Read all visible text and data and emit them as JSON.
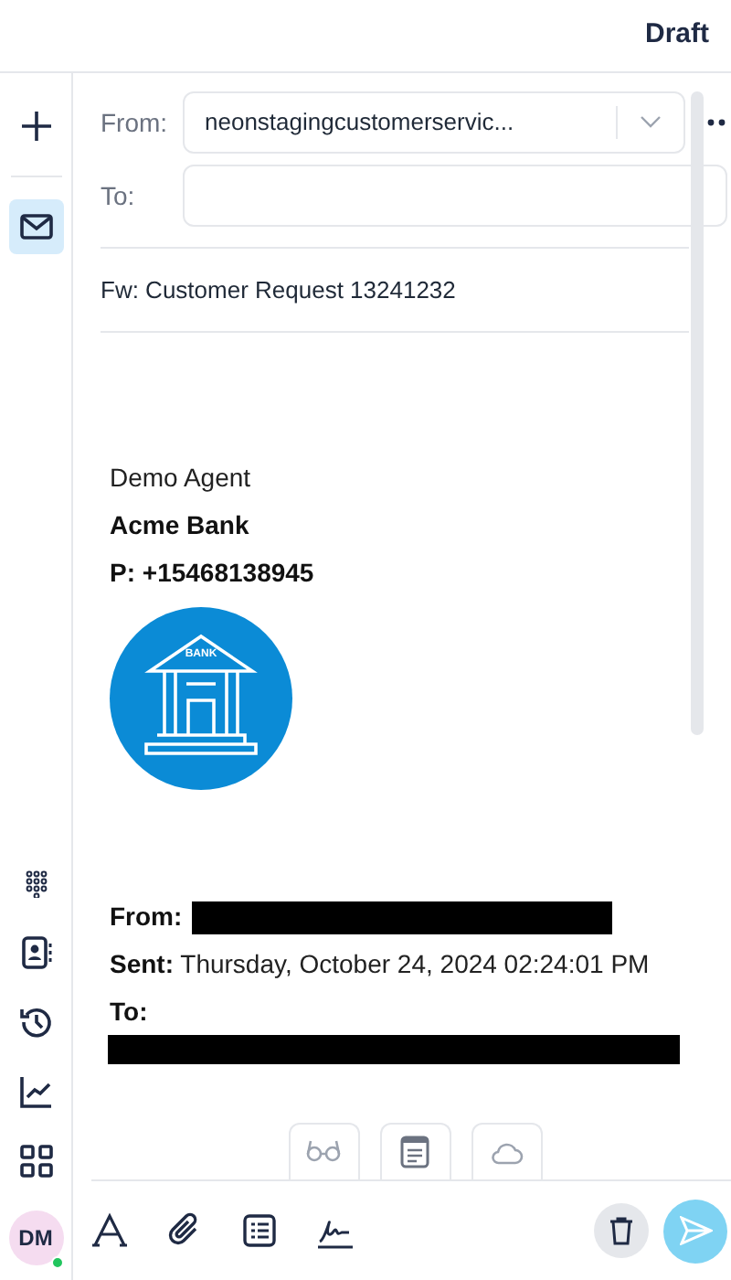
{
  "header": {
    "title": "Draft"
  },
  "rail": {
    "items": [
      {
        "kind": "add",
        "selected": false
      },
      {
        "kind": "mail",
        "selected": true
      }
    ],
    "bottom_items": [
      {
        "kind": "dialpad",
        "selected": false
      },
      {
        "kind": "contacts",
        "selected": false
      },
      {
        "kind": "history",
        "selected": false
      },
      {
        "kind": "analytics",
        "selected": false
      },
      {
        "kind": "apps",
        "selected": false
      }
    ],
    "avatar": {
      "initials": "DM",
      "online": true
    }
  },
  "compose": {
    "from": {
      "label": "From:",
      "value": "neonstagingcustomerservic..."
    },
    "to": {
      "label": "To:"
    },
    "subject": "Fw: Customer Request 13241232"
  },
  "signature": {
    "name": "Demo Agent",
    "company": "Acme Bank",
    "phone": "P: +15468138945",
    "logo_text": "BANK"
  },
  "forwarded": [
    {
      "label": "From:"
    },
    {
      "label": "Sent:",
      "value": "Thursday, October 24, 2024 02:24:01 PM"
    },
    {
      "label": "To:"
    }
  ],
  "app_tabs": [
    {
      "kind": "glasses"
    },
    {
      "kind": "notes"
    },
    {
      "kind": "cloud"
    }
  ],
  "toolbar": [
    {
      "kind": "font"
    },
    {
      "kind": "attach"
    },
    {
      "kind": "template"
    },
    {
      "kind": "signature"
    }
  ]
}
